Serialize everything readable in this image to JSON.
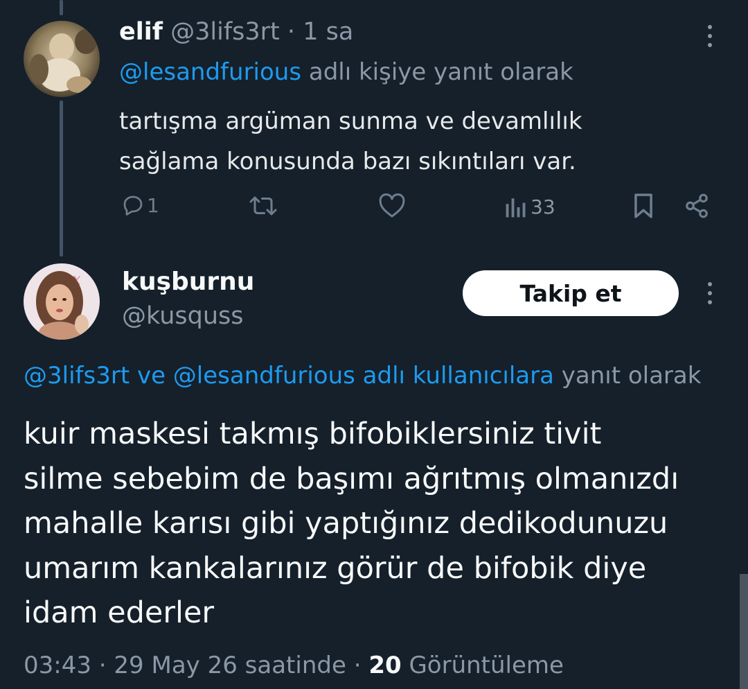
{
  "reply_tweet": {
    "display_name": "elif",
    "handle": "@3lifs3rt",
    "time_separator": "·",
    "time": "1 sa",
    "reply_to_handle": "@lesandfurious",
    "reply_to_suffix": "adlı kişiye yanıt olarak",
    "text_line1": "tartışma argüman sunma ve devamlılık",
    "text_line2": "sağlama konusunda bazı sıkıntıları var.",
    "actions": {
      "reply_count": "1",
      "views_count": "33"
    }
  },
  "main_tweet": {
    "display_name": "kuşburnu",
    "handle": "@kusquss",
    "follow_label": "Takip et",
    "reply_to_handles": "@3lifs3rt ve @lesandfurious adlı kullanıcılara",
    "reply_to_suffix": "yanıt olarak",
    "text_lines": [
      "kuir maskesi takmış bifobiklersiniz tivit",
      "silme sebebim de başımı ağrıtmış olmanızdı",
      "mahalle karısı gibi yaptığınız dedikodunuzu",
      "umarım kankalarınız görür de bifobik diye",
      "idam ederler"
    ],
    "meta": {
      "time": "03:43",
      "sep1": "·",
      "date": "29 May 26 saatinde",
      "sep2": "·",
      "views_count": "20",
      "views_label": "Görüntüleme"
    }
  },
  "icons": [
    "reply-icon",
    "retweet-icon",
    "like-icon",
    "views-icon",
    "bookmark-icon",
    "share-icon",
    "more-icon"
  ],
  "colors": {
    "background": "#15202b",
    "text": "#e7e9ea",
    "muted": "#8b98a5",
    "link": "#1d9bf0",
    "follow_bg": "#ffffff",
    "thread_line": "#425466"
  }
}
